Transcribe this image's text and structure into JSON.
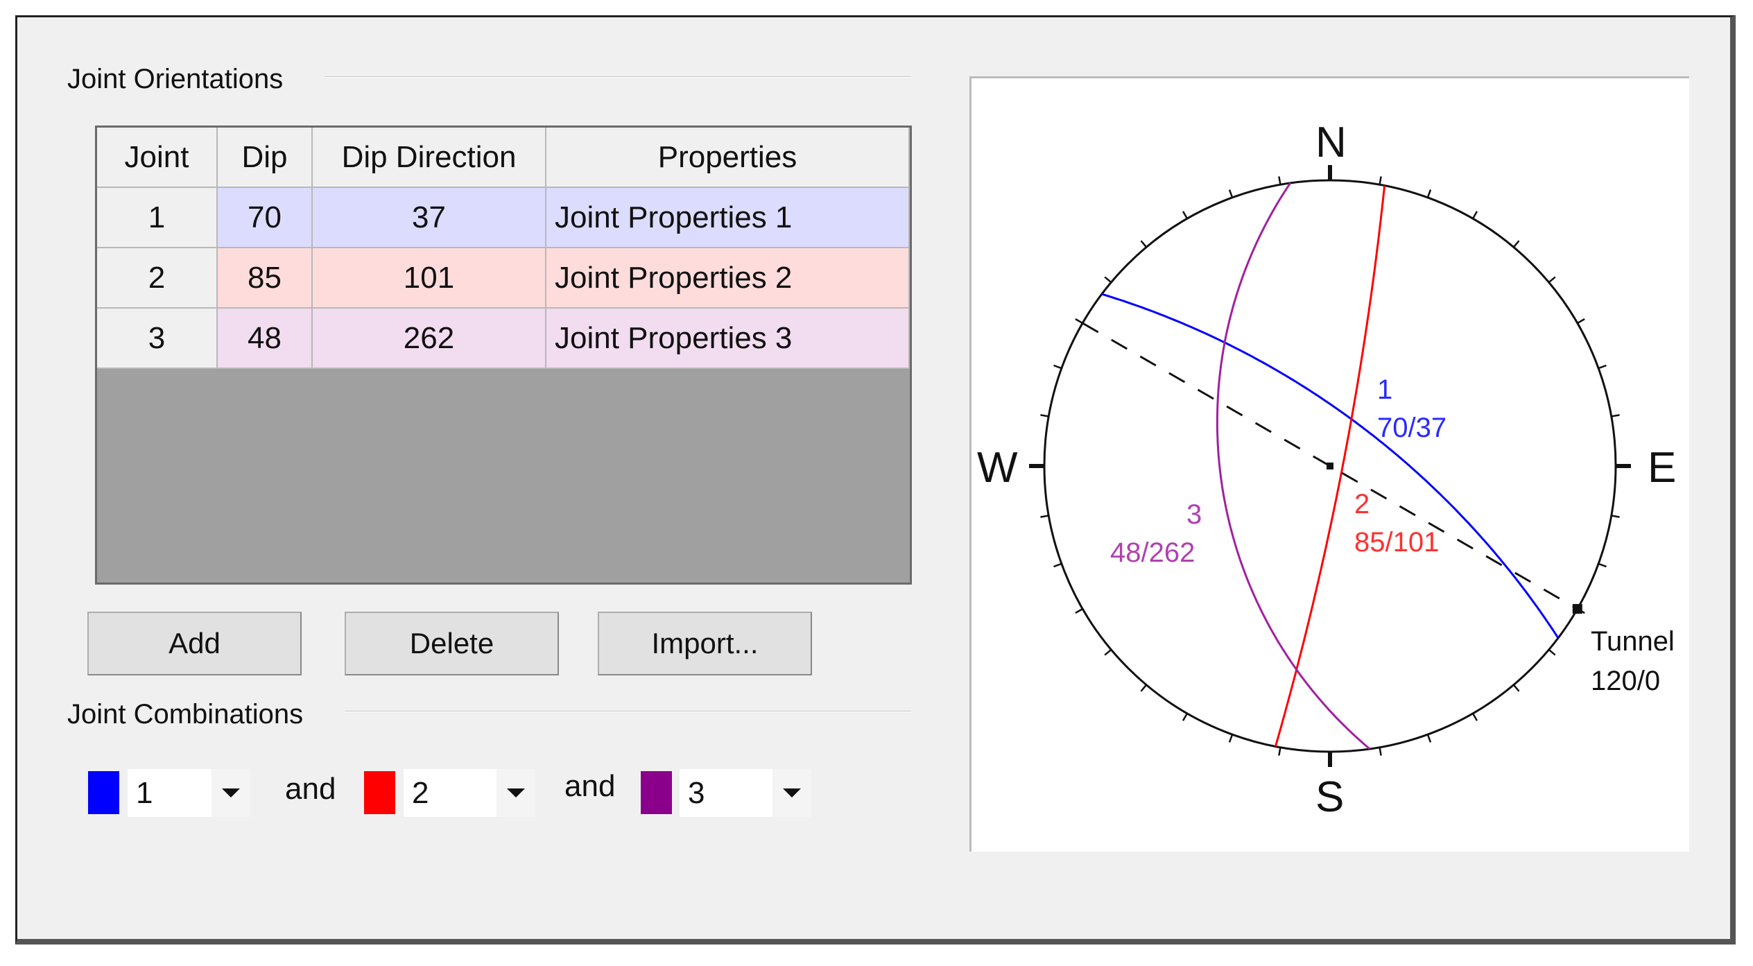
{
  "joint_orientations": {
    "title": "Joint Orientations",
    "columns": [
      "Joint",
      "Dip",
      "Dip Direction",
      "Properties"
    ],
    "rows": [
      {
        "joint": "1",
        "dip": "70",
        "dip_direction": "37",
        "properties": "Joint Properties 1",
        "color": "#dcdcff"
      },
      {
        "joint": "2",
        "dip": "85",
        "dip_direction": "101",
        "properties": "Joint Properties 2",
        "color": "#ffdcdc"
      },
      {
        "joint": "3",
        "dip": "48",
        "dip_direction": "262",
        "properties": "Joint Properties 3",
        "color": "#f2dcf0"
      }
    ]
  },
  "buttons": {
    "add": "Add",
    "delete": "Delete",
    "import": "Import..."
  },
  "joint_combinations": {
    "title": "Joint Combinations",
    "and_label": "and",
    "combos": [
      {
        "value": "1",
        "color": "#0000ff"
      },
      {
        "value": "2",
        "color": "#ff0000"
      },
      {
        "value": "3",
        "color": "#8b008b"
      }
    ]
  },
  "stereonet": {
    "directions": {
      "n": "N",
      "e": "E",
      "s": "S",
      "w": "W"
    },
    "planes": [
      {
        "id": "1",
        "dip": 70,
        "dip_direction": 37,
        "label": "70/37",
        "color": "#0000ff"
      },
      {
        "id": "2",
        "dip": 85,
        "dip_direction": 101,
        "label": "85/101",
        "color": "#ff0000"
      },
      {
        "id": "3",
        "dip": 48,
        "dip_direction": 262,
        "label": "48/262",
        "color": "#a020a0"
      }
    ],
    "tunnel": {
      "name": "Tunnel",
      "trend": 120,
      "plunge": 0,
      "label": "120/0"
    }
  }
}
